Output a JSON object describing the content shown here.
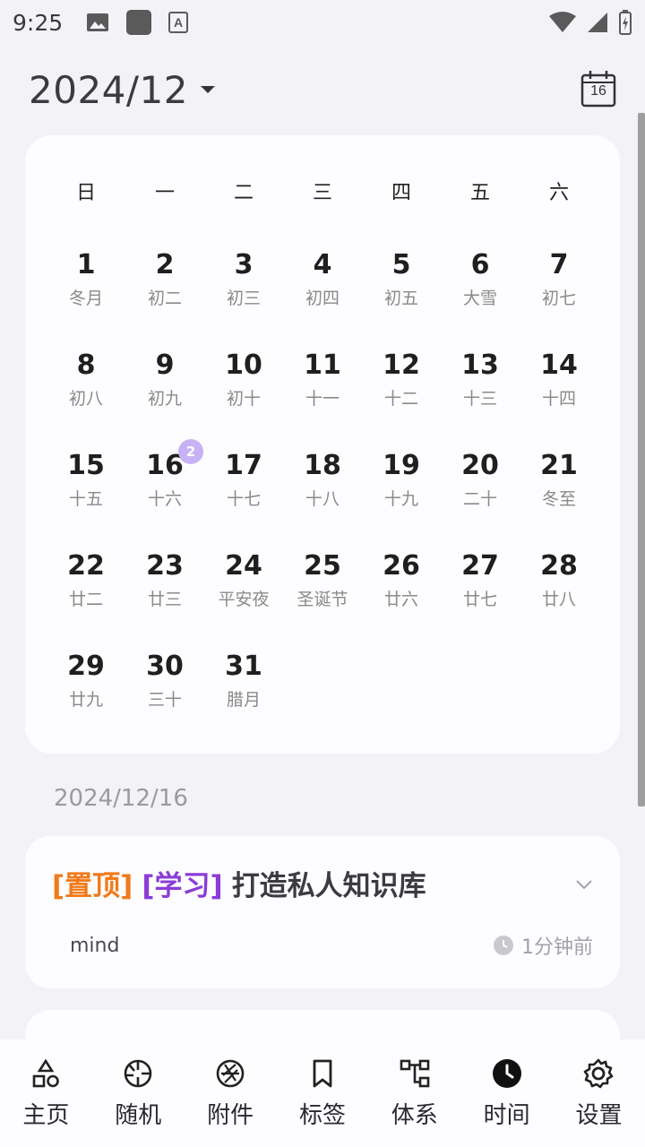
{
  "status_bar": {
    "time": "9:25"
  },
  "header": {
    "month": "2024/12",
    "today_day": "16"
  },
  "calendar": {
    "weekdays": [
      "日",
      "一",
      "二",
      "三",
      "四",
      "五",
      "六"
    ],
    "days": [
      {
        "num": "1",
        "lunar": "冬月"
      },
      {
        "num": "2",
        "lunar": "初二"
      },
      {
        "num": "3",
        "lunar": "初三"
      },
      {
        "num": "4",
        "lunar": "初四"
      },
      {
        "num": "5",
        "lunar": "初五"
      },
      {
        "num": "6",
        "lunar": "大雪"
      },
      {
        "num": "7",
        "lunar": "初七"
      },
      {
        "num": "8",
        "lunar": "初八"
      },
      {
        "num": "9",
        "lunar": "初九"
      },
      {
        "num": "10",
        "lunar": "初十"
      },
      {
        "num": "11",
        "lunar": "十一"
      },
      {
        "num": "12",
        "lunar": "十二"
      },
      {
        "num": "13",
        "lunar": "十三"
      },
      {
        "num": "14",
        "lunar": "十四"
      },
      {
        "num": "15",
        "lunar": "十五"
      },
      {
        "num": "16",
        "lunar": "十六",
        "badge": "2"
      },
      {
        "num": "17",
        "lunar": "十七"
      },
      {
        "num": "18",
        "lunar": "十八"
      },
      {
        "num": "19",
        "lunar": "十九"
      },
      {
        "num": "20",
        "lunar": "二十"
      },
      {
        "num": "21",
        "lunar": "冬至"
      },
      {
        "num": "22",
        "lunar": "廿二"
      },
      {
        "num": "23",
        "lunar": "廿三"
      },
      {
        "num": "24",
        "lunar": "平安夜"
      },
      {
        "num": "25",
        "lunar": "圣诞节"
      },
      {
        "num": "26",
        "lunar": "廿六"
      },
      {
        "num": "27",
        "lunar": "廿七"
      },
      {
        "num": "28",
        "lunar": "廿八"
      },
      {
        "num": "29",
        "lunar": "廿九"
      },
      {
        "num": "30",
        "lunar": "三十"
      },
      {
        "num": "31",
        "lunar": "腊月"
      }
    ]
  },
  "selected_date": "2024/12/16",
  "note": {
    "tag_pin": "[置顶]",
    "tag_category": "[学习]",
    "title": "打造私人知识库",
    "subtitle": "mind",
    "time": "1分钟前"
  },
  "colors": {
    "pin": "#f07a1a",
    "category": "#8a3cd6",
    "badge": "#c7b2f5"
  },
  "bottom_nav": [
    {
      "label": "主页",
      "icon": "home-shapes-icon"
    },
    {
      "label": "随机",
      "icon": "random-icon"
    },
    {
      "label": "附件",
      "icon": "attachment-aperture-icon"
    },
    {
      "label": "标签",
      "icon": "bookmark-icon"
    },
    {
      "label": "体系",
      "icon": "hierarchy-icon"
    },
    {
      "label": "时间",
      "icon": "clock-icon"
    },
    {
      "label": "设置",
      "icon": "gear-icon"
    }
  ]
}
